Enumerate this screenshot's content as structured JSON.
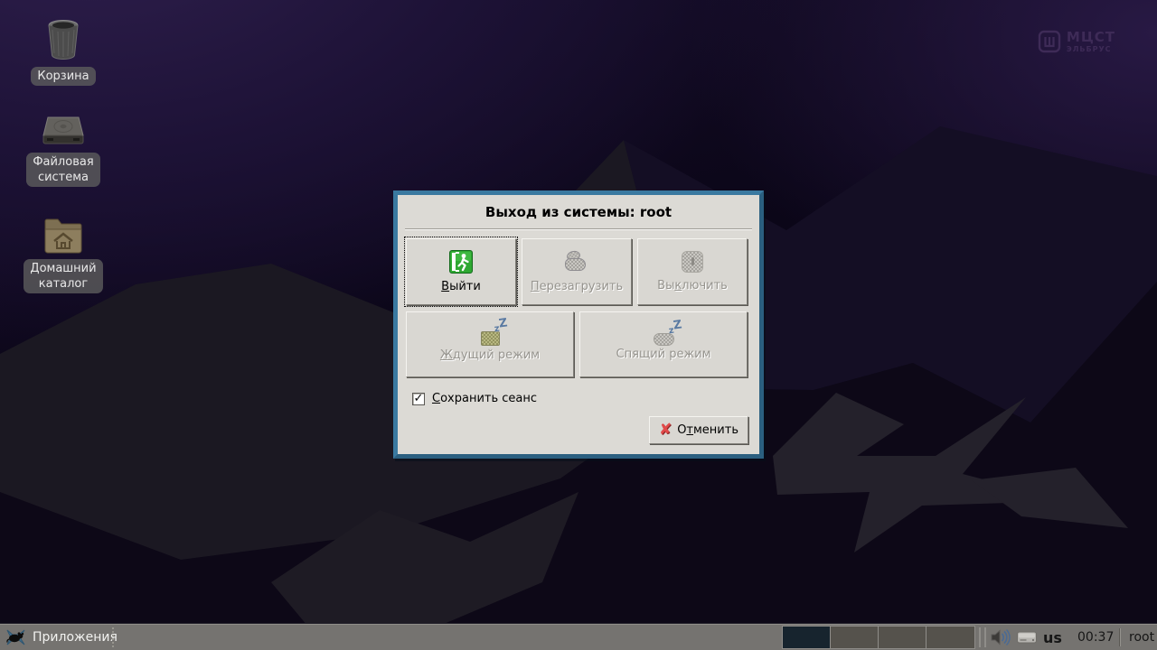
{
  "desktop": {
    "icons": [
      {
        "id": "trash",
        "label": "Корзина"
      },
      {
        "id": "filesystem",
        "label": "Файловая\nсистема"
      },
      {
        "id": "home",
        "label": "Домашний\nкаталог"
      }
    ],
    "branding": {
      "name": "МЦСТ",
      "sub": "ЭЛЬБРУС"
    }
  },
  "dialog": {
    "title": "Выход из системы: root",
    "buttons": {
      "logout": {
        "pre": "",
        "mn": "В",
        "post": "ыйти"
      },
      "restart": {
        "pre": "",
        "mn": "П",
        "post": "ерезагрузить"
      },
      "shutdown": {
        "pre": "Вы",
        "mn": "к",
        "post": "лючить"
      },
      "standby": {
        "pre": "",
        "mn": "Ж",
        "post": "дущий режим"
      },
      "hibernate": {
        "pre": "Спящий режим",
        "mn": "",
        "post": ""
      }
    },
    "save_session": {
      "pre": "",
      "mn": "С",
      "post": "охранить сеанс",
      "checked": true
    },
    "cancel": {
      "pre": "О",
      "mn": "т",
      "post": "менить"
    }
  },
  "panel": {
    "applications": "Приложения",
    "workspace_count": 4,
    "active_workspace": 1,
    "keyboard_layout": "us",
    "clock": "00:37",
    "user": "root"
  },
  "icons": {
    "check": "✓",
    "cancel_x": "✘",
    "z_small": "z",
    "z_big": "Z"
  },
  "colors": {
    "dialog_border": "#336e91",
    "dialog_bg": "#dcdad5",
    "panel_bg": "#757370",
    "active_workspace": "#17242e",
    "logo_purple": "#3e2b57",
    "exit_green": "#2fa832",
    "cancel_red": "#e24a4a",
    "wallpaper_purple": "#2a1a45"
  }
}
